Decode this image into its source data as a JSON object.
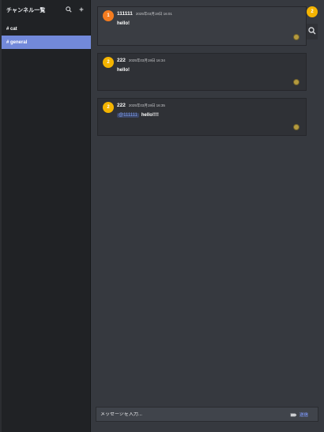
{
  "sidebar": {
    "title": "チャンネル一覧",
    "channels": [
      {
        "label": "# cat",
        "active": false
      },
      {
        "label": "# general",
        "active": true
      }
    ]
  },
  "messages": [
    {
      "user": "111111",
      "time": "2025年03月19日 16:01",
      "avatar_initial": "1",
      "avatar_color": "#f57c1f",
      "text": "hello!",
      "mention": ""
    },
    {
      "user": "222",
      "time": "2025年03月19日 16:34",
      "avatar_initial": "2",
      "avatar_color": "#f4b400",
      "text": "hello!",
      "mention": ""
    },
    {
      "user": "222",
      "time": "2025年03月19日 16:35",
      "avatar_initial": "2",
      "avatar_color": "#f4b400",
      "text": "hello!!!!",
      "mention": "@111111"
    }
  ],
  "rail": {
    "avatar_initial": "2"
  },
  "composer": {
    "placeholder": "メッセージを入力...",
    "send_label": "送信"
  },
  "colors": {
    "accent": "#7289da",
    "sidebar_bg": "#202225",
    "main_bg": "#36393f"
  }
}
